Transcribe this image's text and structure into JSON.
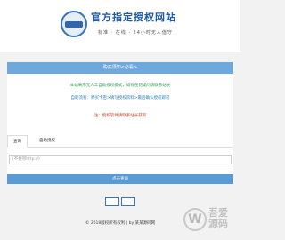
{
  "header": {
    "title": "官方指定授权网站",
    "subtitle": "标准 · 在线 · 24小时无人值守",
    "logo_text": ""
  },
  "notice": {
    "title": "购买须知<必看>",
    "line1": "本站采用无人工自助授权模式，如有任何疑问请联系站长",
    "line2": "自助流程：购买卡密>填写授权资料>最后确认授权即可",
    "line3": "注：授权软件请联系站长获取"
  },
  "tabs": {
    "tab1": "查询",
    "tab2": "自助授权"
  },
  "form": {
    "input_placeholder": "(不要带http://)"
  },
  "search": {
    "button_label": "点击查询"
  },
  "buttons": {
    "btn1": "",
    "btn2": ""
  },
  "footer": {
    "text": "© 2018版权所有权利 | by 某某源码网"
  },
  "watermark": {
    "glyph": "W",
    "title": "吾爱源码",
    "sub": ""
  },
  "colors": {
    "accent": "#5b9bd5",
    "brand": "#1f5aa6",
    "green_text": "#2a9a4a",
    "red_text": "#d0402a"
  }
}
